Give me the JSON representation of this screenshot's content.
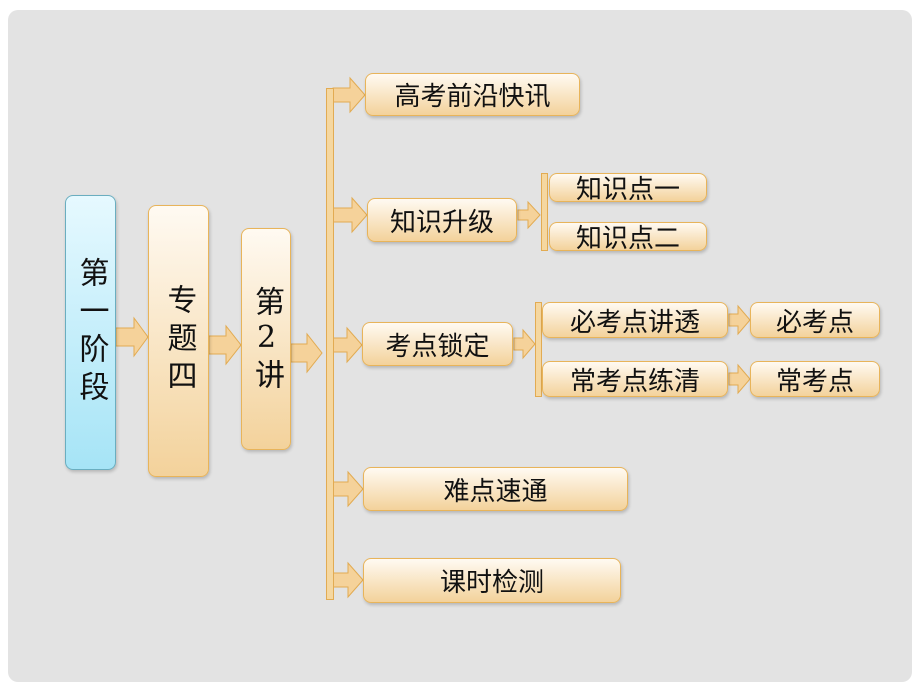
{
  "stage": "第一阶段",
  "topic": "专题四",
  "lecture": "第2讲",
  "branches": [
    "高考前沿快讯",
    "知识升级",
    "考点锁定",
    "难点速通",
    "课时检测"
  ],
  "knowledge": [
    "知识点一",
    "知识点二"
  ],
  "exam": [
    "必考点讲透",
    "常考点练清"
  ],
  "exam_results": [
    "必考点",
    "常考点"
  ],
  "colors": {
    "orange_border": "#e8b45a",
    "orange_fill": "#f3d29b",
    "blue_fill": "#a6e4f6",
    "background": "#e3e3e3"
  }
}
